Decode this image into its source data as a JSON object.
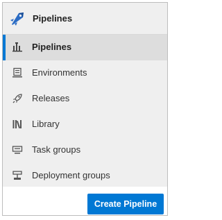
{
  "header": {
    "title": "Pipelines",
    "icon": "azure-pipelines-logo-icon"
  },
  "menu": {
    "items": [
      {
        "label": "Pipelines",
        "icon": "pipelines-icon",
        "selected": true
      },
      {
        "label": "Environments",
        "icon": "environments-icon",
        "selected": false
      },
      {
        "label": "Releases",
        "icon": "rocket-icon",
        "selected": false
      },
      {
        "label": "Library",
        "icon": "library-icon",
        "selected": false
      },
      {
        "label": "Task groups",
        "icon": "task-groups-icon",
        "selected": false
      },
      {
        "label": "Deployment groups",
        "icon": "deployment-groups-icon",
        "selected": false
      }
    ]
  },
  "actions": {
    "create_label": "Create Pipeline"
  },
  "colors": {
    "accent": "#0078d4",
    "menu_bg": "#efefef",
    "selected_bg": "#dddddd"
  }
}
